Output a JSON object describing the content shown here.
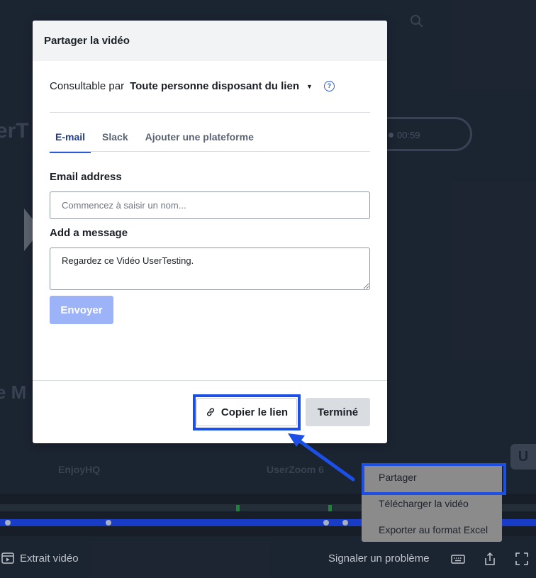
{
  "dialog": {
    "title": "Partager la vidéo",
    "visibility_label": "Consultable par",
    "visibility_value": "Toute personne disposant du lien",
    "help_glyph": "?",
    "tabs": [
      {
        "label": "E-mail",
        "active": true
      },
      {
        "label": "Slack",
        "active": false
      },
      {
        "label": "Ajouter une plateforme",
        "active": false
      }
    ],
    "email_label": "Email address",
    "email_placeholder": "Commencez à saisir un nom...",
    "message_label": "Add a message",
    "message_value": "Regardez ce Vidéo UserTesting.",
    "send_label": "Envoyer",
    "copy_link_label": "Copier le lien",
    "done_label": "Terminé"
  },
  "context_menu": {
    "items": [
      {
        "label": "Partager",
        "highlighted": true
      },
      {
        "label": "Télécharger la vidéo"
      },
      {
        "label": "Exporter au format Excel"
      }
    ]
  },
  "background": {
    "title_fragment": "erT",
    "section_fragment": "e M",
    "time": "00:59",
    "labels": [
      "EnjoyHQ",
      "UserZoom 6"
    ],
    "logo_letter": "U",
    "clip_label": "Extrait vidéo",
    "report_label": "Signaler un problème"
  },
  "colors": {
    "accent": "#2a5bd7",
    "highlight_frame": "#1c4fe6",
    "send_disabled": "#9db3f7",
    "progress": "#1a3fd1",
    "menu_bg": "#8b8b8b"
  },
  "icons": {
    "copy": "link-icon",
    "help": "question-circle-icon",
    "clip": "video-clip-icon",
    "keyboard": "keyboard-icon",
    "share": "share-icon",
    "fullscreen": "fullscreen-icon"
  }
}
